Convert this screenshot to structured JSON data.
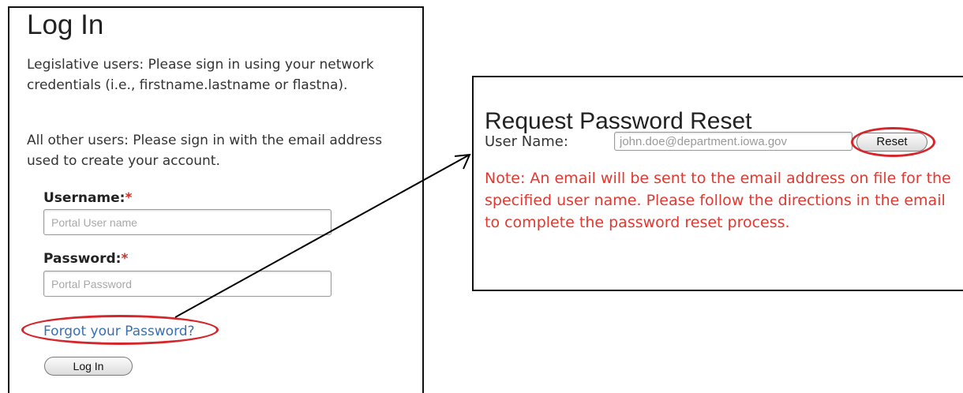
{
  "login": {
    "title": "Log In",
    "paragraph_1": "Legislative users: Please sign in using your network credentials (i.e., firstname.lastname or flastna).",
    "paragraph_2": "All other users: Please sign in with the email address used to create your account.",
    "username_label": "Username:",
    "password_label": "Password:",
    "required_marker": "*",
    "username_placeholder": "Portal User name",
    "password_placeholder": "Portal Password",
    "forgot_link": "Forgot your Password?",
    "login_button": "Log In"
  },
  "reset": {
    "title": "Request Password Reset",
    "username_label": "User Name:",
    "username_value": "john.doe@department.iowa.gov",
    "reset_button": "Reset",
    "note": "Note: An email will be sent to the email address on file for the specified user name. Please follow the directions in the email to complete the password reset process."
  },
  "annotations": {
    "highlight_color": "#d4262b",
    "arrow_color": "#000000"
  },
  "colors": {
    "link": "#3a6fb0",
    "required": "#d0302b",
    "note_text": "#e2382f"
  }
}
